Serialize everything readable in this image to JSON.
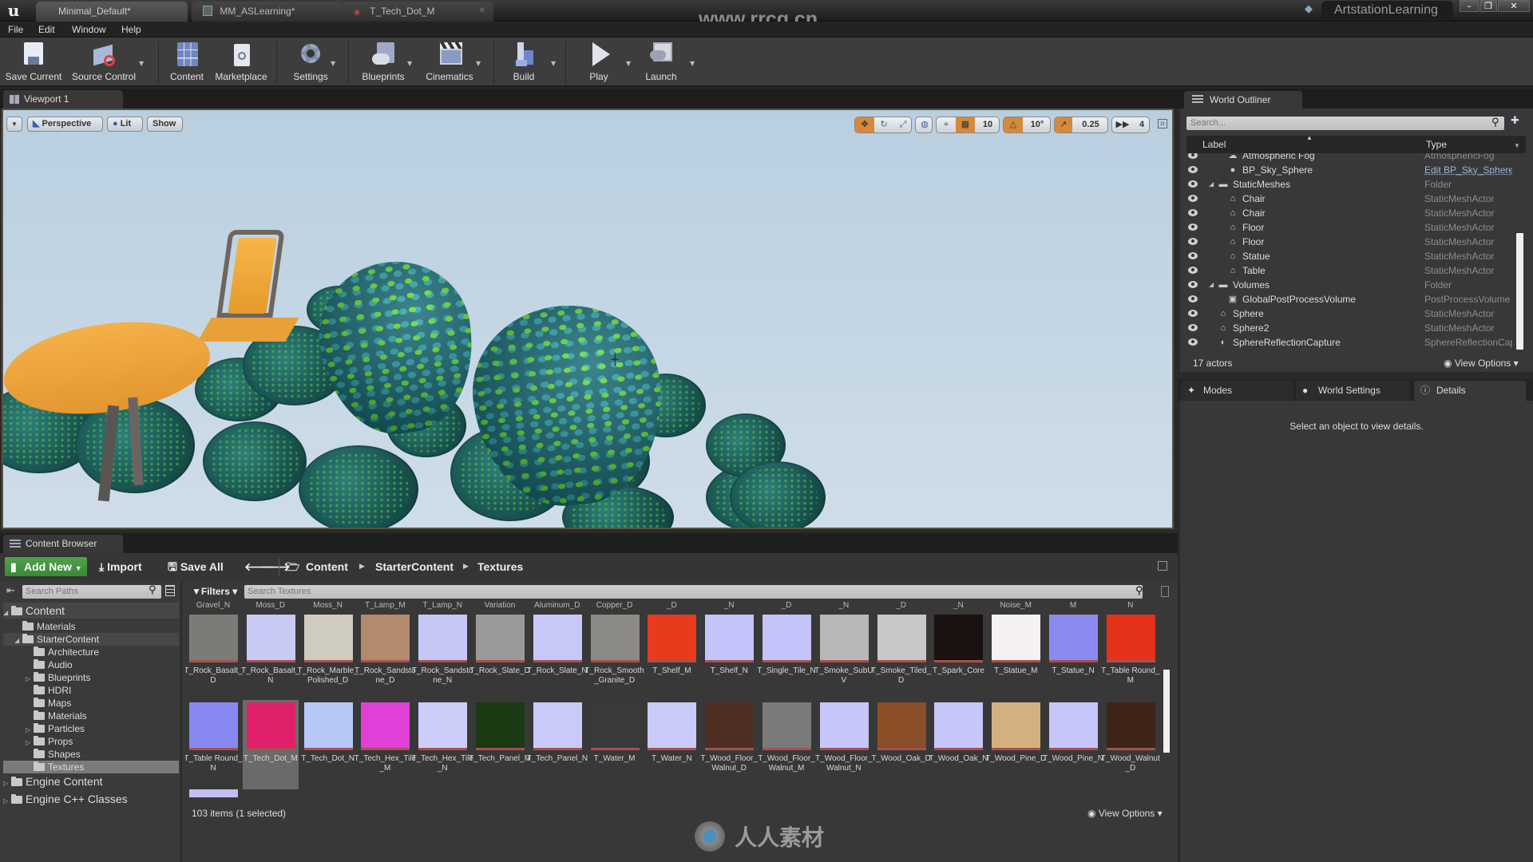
{
  "window": {
    "tabs": [
      {
        "label": "Minimal_Default*",
        "icon": "level-icon",
        "active": true
      },
      {
        "label": "MM_ASLearning*",
        "icon": "material-icon",
        "active": false
      },
      {
        "label": "T_Tech_Dot_M",
        "icon": "texture-icon",
        "active": false
      }
    ],
    "project_name": "ArtstationLearning",
    "watermark_url": "www.rrcg.cn",
    "controls": {
      "minimize": "–",
      "restore": "❐",
      "close": "✕"
    }
  },
  "menu": [
    "File",
    "Edit",
    "Window",
    "Help"
  ],
  "toolbar": [
    {
      "label": "Save Current",
      "icon": "save-icon",
      "dropdown": false
    },
    {
      "label": "Source Control",
      "icon": "source-control-icon",
      "dropdown": true
    },
    {
      "label": "Content",
      "icon": "content-icon",
      "dropdown": false
    },
    {
      "label": "Marketplace",
      "icon": "marketplace-icon",
      "dropdown": false
    },
    {
      "label": "Settings",
      "icon": "settings-icon",
      "dropdown": true
    },
    {
      "label": "Blueprints",
      "icon": "blueprints-icon",
      "dropdown": true
    },
    {
      "label": "Cinematics",
      "icon": "cinematics-icon",
      "dropdown": true
    },
    {
      "label": "Build",
      "icon": "build-icon",
      "dropdown": true
    },
    {
      "label": "Play",
      "icon": "play-icon",
      "dropdown": true
    },
    {
      "label": "Launch",
      "icon": "launch-icon",
      "dropdown": true
    }
  ],
  "viewport": {
    "tab_label": "Viewport 1",
    "view_mode": "Perspective",
    "lighting": "Lit",
    "show_label": "Show",
    "grid_snap": "10",
    "rotation_snap": "10°",
    "scale_snap": "0.25",
    "camera_speed": "4"
  },
  "outliner": {
    "tab_label": "World Outliner",
    "search_placeholder": "Search...",
    "col_label": "Label",
    "col_type": "Type",
    "rows": [
      {
        "label": "Atmospheric Fog",
        "type": "AtmosphericFog",
        "depth": 2,
        "icon": "fog-icon"
      },
      {
        "label": "BP_Sky_Sphere",
        "type": "Edit BP_Sky_Sphere",
        "depth": 2,
        "icon": "sphere-icon",
        "link": true
      },
      {
        "label": "StaticMeshes",
        "type": "Folder",
        "depth": 1,
        "icon": "folder-icon",
        "expanded": true
      },
      {
        "label": "Chair",
        "type": "StaticMeshActor",
        "depth": 2,
        "icon": "mesh-icon"
      },
      {
        "label": "Chair",
        "type": "StaticMeshActor",
        "depth": 2,
        "icon": "mesh-icon"
      },
      {
        "label": "Floor",
        "type": "StaticMeshActor",
        "depth": 2,
        "icon": "mesh-icon"
      },
      {
        "label": "Floor",
        "type": "StaticMeshActor",
        "depth": 2,
        "icon": "mesh-icon"
      },
      {
        "label": "Statue",
        "type": "StaticMeshActor",
        "depth": 2,
        "icon": "mesh-icon"
      },
      {
        "label": "Table",
        "type": "StaticMeshActor",
        "depth": 2,
        "icon": "mesh-icon"
      },
      {
        "label": "Volumes",
        "type": "Folder",
        "depth": 1,
        "icon": "folder-icon",
        "expanded": true
      },
      {
        "label": "GlobalPostProcessVolume",
        "type": "PostProcessVolume",
        "depth": 2,
        "icon": "volume-icon"
      },
      {
        "label": "Sphere",
        "type": "StaticMeshActor",
        "depth": 1,
        "icon": "mesh-icon"
      },
      {
        "label": "Sphere2",
        "type": "StaticMeshActor",
        "depth": 1,
        "icon": "mesh-icon"
      },
      {
        "label": "SphereReflectionCapture",
        "type": "SphereReflectionCapture",
        "depth": 1,
        "icon": "reflection-icon"
      }
    ],
    "actor_count": "17 actors",
    "view_options": "View Options"
  },
  "details": {
    "tabs": [
      {
        "label": "Modes",
        "icon": "modes-icon"
      },
      {
        "label": "World Settings",
        "icon": "world-icon"
      },
      {
        "label": "Details",
        "icon": "details-icon"
      }
    ],
    "empty_message": "Select an object to view details."
  },
  "content_browser": {
    "tab_label": "Content Browser",
    "add_new": "Add New",
    "import": "Import",
    "save_all": "Save All",
    "breadcrumb": [
      "Content",
      "StarterContent",
      "Textures"
    ],
    "paths_placeholder": "Search Paths",
    "filters": "Filters",
    "asset_search_placeholder": "Search Textures",
    "tree": [
      {
        "label": "Content",
        "depth": 0,
        "arrow": "expanded",
        "big": true
      },
      {
        "label": "Materials",
        "depth": 1,
        "arrow": "none"
      },
      {
        "label": "StarterContent",
        "depth": 1,
        "arrow": "expanded"
      },
      {
        "label": "Architecture",
        "depth": 2,
        "arrow": "none"
      },
      {
        "label": "Audio",
        "depth": 2,
        "arrow": "none"
      },
      {
        "label": "Blueprints",
        "depth": 2,
        "arrow": "collapsed"
      },
      {
        "label": "HDRI",
        "depth": 2,
        "arrow": "none"
      },
      {
        "label": "Maps",
        "depth": 2,
        "arrow": "none"
      },
      {
        "label": "Materials",
        "depth": 2,
        "arrow": "none"
      },
      {
        "label": "Particles",
        "depth": 2,
        "arrow": "collapsed"
      },
      {
        "label": "Props",
        "depth": 2,
        "arrow": "collapsed"
      },
      {
        "label": "Shapes",
        "depth": 2,
        "arrow": "none"
      },
      {
        "label": "Textures",
        "depth": 2,
        "arrow": "none",
        "selected": true
      },
      {
        "label": "Engine Content",
        "depth": 0,
        "arrow": "collapsed",
        "big": true
      },
      {
        "label": "Engine C++ Classes",
        "depth": 0,
        "arrow": "collapsed",
        "big": true
      }
    ],
    "top_partial_labels": [
      "Gravel_N",
      "Moss_D",
      "Moss_N",
      "T_Lamp_M",
      "T_Lamp_N",
      "Variation",
      "Aluminum_D",
      "Copper_D",
      "_D",
      "_N",
      "_D",
      "_N",
      "_D",
      "_N",
      "Noise_M",
      "M",
      "N"
    ],
    "assets_row1": [
      {
        "name": "T_Rock_Basalt_D",
        "color": "#7a7c78"
      },
      {
        "name": "T_Rock_Basalt_N",
        "color": "#c9c9f6"
      },
      {
        "name": "T_Rock_Marble_Polished_D",
        "color": "#cfcbc0"
      },
      {
        "name": "T_Rock_Sandstone_D",
        "color": "#b48a6c"
      },
      {
        "name": "T_Rock_Sandstone_N",
        "color": "#c7c7f7"
      },
      {
        "name": "T_Rock_Slate_D",
        "color": "#9a9a98"
      },
      {
        "name": "T_Rock_Slate_N",
        "color": "#c8c8f8"
      },
      {
        "name": "T_Rock_Smooth_Granite_D",
        "color": "#8c8a86"
      },
      {
        "name": "T_Shelf_M",
        "color": "#e83a1c"
      },
      {
        "name": "T_Shelf_N",
        "color": "#c4c4fa"
      },
      {
        "name": "T_Single_Tile_N",
        "color": "#c4c4fa"
      },
      {
        "name": "T_Smoke_SubUV",
        "color": "#b8b8b8"
      },
      {
        "name": "T_Smoke_Tiled_D",
        "color": "#c8c8c8"
      },
      {
        "name": "T_Spark_Core",
        "color": "#1a1210"
      },
      {
        "name": "T_Statue_M",
        "color": "#f4f0f4"
      },
      {
        "name": "T_Statue_N",
        "color": "#8a8af0"
      },
      {
        "name": "T_Table Round_M",
        "color": "#e3311a"
      }
    ],
    "assets_row2": [
      {
        "name": "T_Table Round_N",
        "color": "#8888f2"
      },
      {
        "name": "T_Tech_Dot_M",
        "color": "#e0206a",
        "selected": true
      },
      {
        "name": "T_Tech_Dot_N",
        "color": "#b8c8f6"
      },
      {
        "name": "T_Tech_Hex_Tile_M",
        "color": "#e040d8"
      },
      {
        "name": "T_Tech_Hex_Tile_N",
        "color": "#cccdf8"
      },
      {
        "name": "T_Tech_Panel_M",
        "color": "#1a3a14"
      },
      {
        "name": "T_Tech_Panel_N",
        "color": "#c9c9fa"
      },
      {
        "name": "T_Water_M",
        "color": "#3a3a3a"
      },
      {
        "name": "T_Water_N",
        "color": "#cacaf8"
      },
      {
        "name": "T_Wood_Floor_Walnut_D",
        "color": "#4e2e22"
      },
      {
        "name": "T_Wood_Floor_Walnut_M",
        "color": "#7a7a7a"
      },
      {
        "name": "T_Wood_Floor_Walnut_N",
        "color": "#c6c6fa"
      },
      {
        "name": "T_Wood_Oak_D",
        "color": "#8a4e28"
      },
      {
        "name": "T_Wood_Oak_N",
        "color": "#c6c6fa"
      },
      {
        "name": "T_Wood_Pine_D",
        "color": "#d4b080"
      },
      {
        "name": "T_Wood_Pine_N",
        "color": "#c6c6fa"
      },
      {
        "name": "T_Wood_Walnut_D",
        "color": "#3e2418"
      }
    ],
    "status": "103 items (1 selected)",
    "view_options": "View Options"
  },
  "footer_watermark": "人人素材",
  "colors": {
    "accent_orange": "#d58a3a",
    "add_new_green": "#4fa24a",
    "panel_bg": "#383838"
  }
}
